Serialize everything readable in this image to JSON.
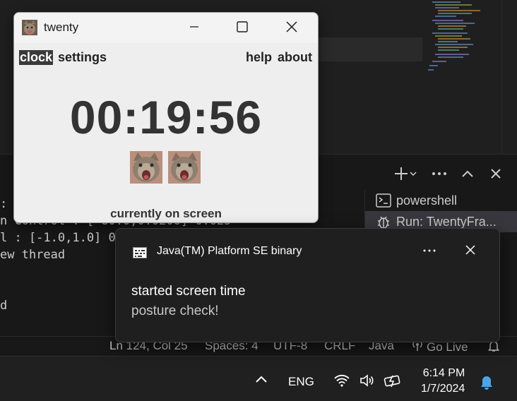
{
  "app_window": {
    "title": "twenty",
    "app_icon": "cat-photo-icon",
    "menu": {
      "left": [
        "clock",
        "settings"
      ],
      "right": [
        "help",
        "about"
      ],
      "active": "clock"
    },
    "timer": "00:19:56",
    "status": "currently on screen"
  },
  "notification": {
    "app_name": "Java(TM) Platform SE binary",
    "title": "started screen time",
    "body": "posture check!"
  },
  "terminal": {
    "lines": [
      ": E",
      "n Control : [-80.0,0.0206] 0.625",
      "l : [-1.0,1.0] 0",
      "ew thread",
      "d"
    ],
    "list": [
      "powershell",
      "Run: TwentyFra..."
    ]
  },
  "status_bar": {
    "position": "Ln 124, Col 25",
    "spaces": "Spaces: 4",
    "encoding": "UTF-8",
    "eol": "CRLF",
    "language": "Java",
    "go_live": "Go Live"
  },
  "taskbar": {
    "language": "ENG",
    "time": "6:14 PM",
    "date": "1/7/2024"
  },
  "colors": {
    "accent_blue": "#4aa6e8",
    "toast_bg": "#1f1f1f",
    "app_bg": "#eeeeee"
  }
}
